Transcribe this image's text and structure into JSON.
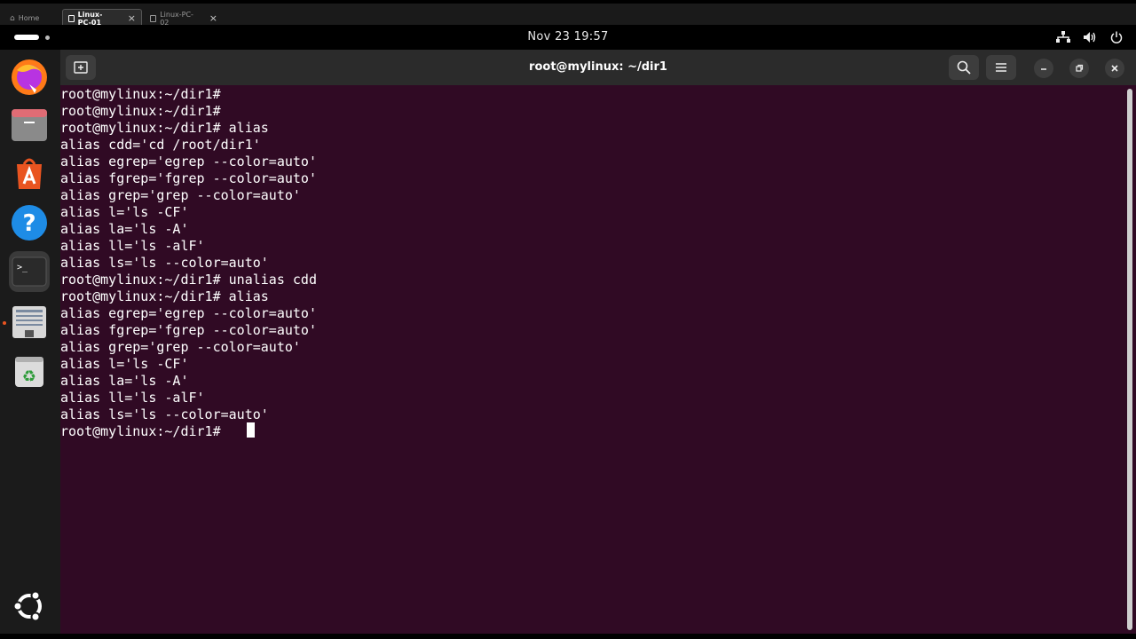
{
  "vm_tabs": [
    {
      "label": "Home",
      "icon": "home-icon",
      "active": false
    },
    {
      "label": "Linux-PC-01",
      "icon": "vm-icon",
      "active": true
    },
    {
      "label": "Linux-PC-02",
      "icon": "vm-icon",
      "active": false
    }
  ],
  "topbar": {
    "clock": "Nov 23  19:57",
    "tray_icons": [
      "network-icon",
      "volume-icon",
      "power-icon"
    ]
  },
  "dock": {
    "items": [
      "firefox-icon",
      "files-icon",
      "app-center-icon",
      "help-icon",
      "terminal-icon",
      "text-editor-icon",
      "trash-icon"
    ],
    "show_apps": "ubuntu-show-apps-icon",
    "running_indicator_color": "#e95420"
  },
  "terminal": {
    "title": "root@mylinux: ~/dir1",
    "background": "#300a24",
    "lines": [
      "root@mylinux:~/dir1#",
      "root@mylinux:~/dir1#",
      "root@mylinux:~/dir1# alias",
      "alias cdd='cd /root/dir1'",
      "alias egrep='egrep --color=auto'",
      "alias fgrep='fgrep --color=auto'",
      "alias grep='grep --color=auto'",
      "alias l='ls -CF'",
      "alias la='ls -A'",
      "alias ll='ls -alF'",
      "alias ls='ls --color=auto'",
      "root@mylinux:~/dir1# unalias cdd",
      "root@mylinux:~/dir1# alias",
      "alias egrep='egrep --color=auto'",
      "alias fgrep='fgrep --color=auto'",
      "alias grep='grep --color=auto'",
      "alias l='ls -CF'",
      "alias la='ls -A'",
      "alias ll='ls -alF'",
      "alias ls='ls --color=auto'",
      "root@mylinux:~/dir1# "
    ]
  }
}
